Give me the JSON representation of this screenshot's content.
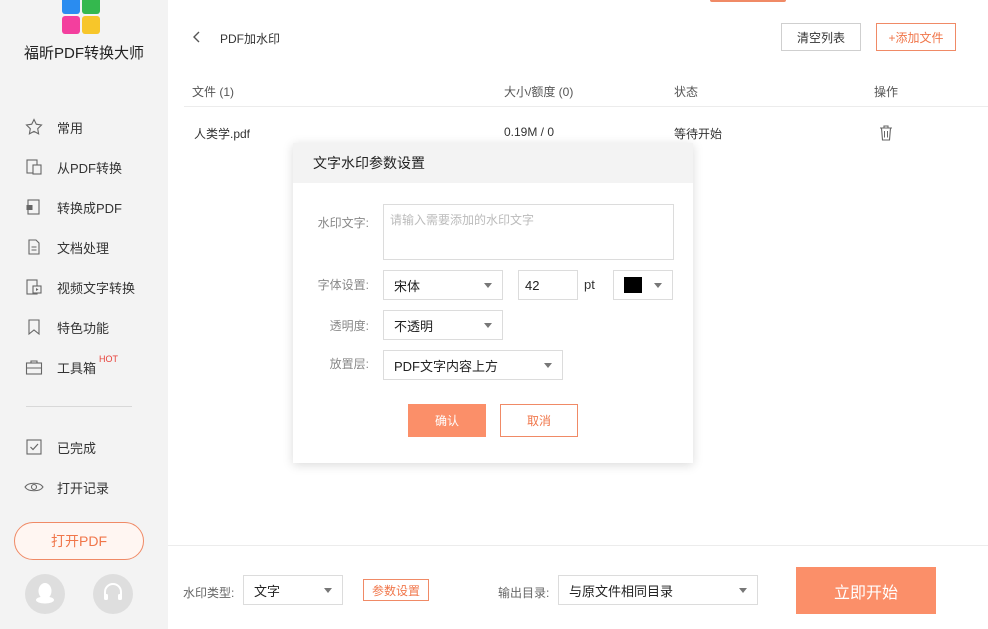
{
  "app": {
    "title": "福昕PDF转换大师",
    "brand_colors": [
      "#f33f56",
      "#34b84e",
      "#2a8cf0",
      "#f7c62a"
    ]
  },
  "sidebar": {
    "items": [
      {
        "label": "常用",
        "icon": "star-icon"
      },
      {
        "label": "从PDF转换",
        "icon": "document-convert-icon"
      },
      {
        "label": "转换成PDF",
        "icon": "document-pdf-icon"
      },
      {
        "label": "文档处理",
        "icon": "document-icon"
      },
      {
        "label": "视频文字转换",
        "icon": "video-text-icon"
      },
      {
        "label": "特色功能",
        "icon": "bookmark-icon"
      },
      {
        "label": "工具箱",
        "icon": "toolbox-icon",
        "badge": "HOT"
      }
    ],
    "secondary": [
      {
        "label": "已完成",
        "icon": "check-icon"
      },
      {
        "label": "打开记录",
        "icon": "eye-icon"
      }
    ],
    "open_pdf_label": "打开PDF"
  },
  "header": {
    "title": "PDF加水印",
    "clear_label": "清空列表",
    "add_label": "+添加文件"
  },
  "table": {
    "columns": [
      "文件 (1)",
      "大小/额度 (0)",
      "状态",
      "操作"
    ],
    "rows": [
      {
        "name": "人类学.pdf",
        "size": "0.19M / 0",
        "status": "等待开始"
      }
    ]
  },
  "dialog": {
    "title": "文字水印参数设置",
    "text_label": "水印文字:",
    "text_placeholder": "请输入需要添加的水印文字",
    "font_label": "字体设置:",
    "font_value": "宋体",
    "size_value": "42",
    "size_unit": "pt",
    "color": "#000000",
    "opacity_label": "透明度:",
    "opacity_value": "不透明",
    "layer_label": "放置层:",
    "layer_value": "PDF文字内容上方",
    "confirm_label": "确认",
    "cancel_label": "取消"
  },
  "bottom": {
    "type_label": "水印类型:",
    "type_value": "文字",
    "params_label": "参数设置",
    "output_label": "输出目录:",
    "output_value": "与原文件相同目录",
    "start_label": "立即开始"
  },
  "accent": "#fb8f69"
}
